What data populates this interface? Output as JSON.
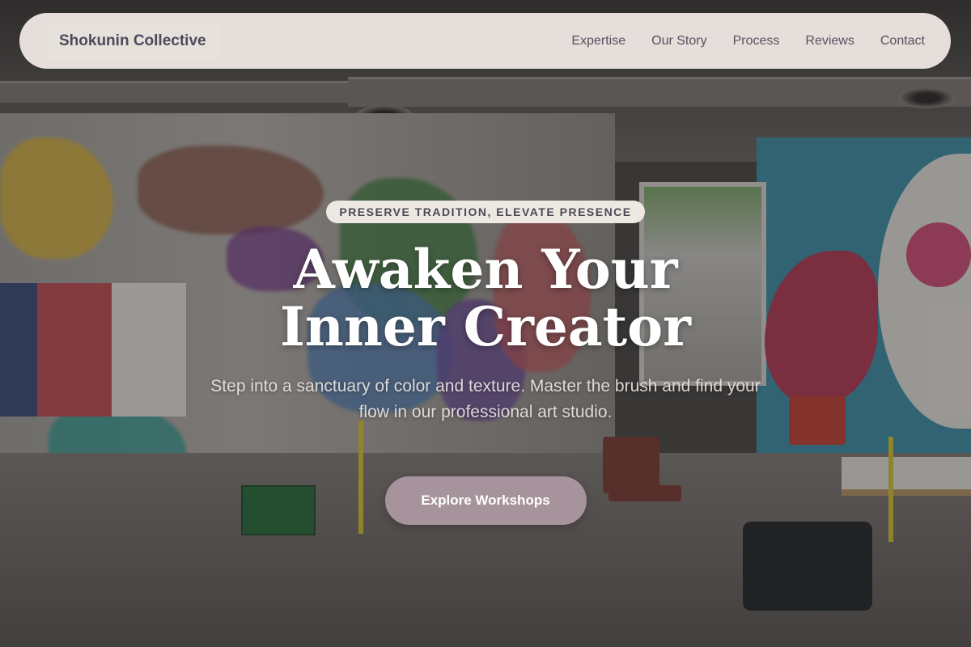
{
  "nav": {
    "brand": "Shokunin Collective",
    "links": [
      "Expertise",
      "Our Story",
      "Process",
      "Reviews",
      "Contact"
    ]
  },
  "hero": {
    "tagline": "PRESERVE TRADITION, ELEVATE PRESENCE",
    "headline_line1": "Awaken Your",
    "headline_line2": "Inner Creator",
    "subtext": "Step into a sanctuary of color and texture. Master the brush and find your flow in our professional art studio.",
    "cta_label": "Explore Workshops"
  },
  "colors": {
    "navbar_bg": "#f0e9e4",
    "brand_text": "#4d4a5c",
    "cta_bg": "#a7939c",
    "headline": "#ffffff"
  }
}
